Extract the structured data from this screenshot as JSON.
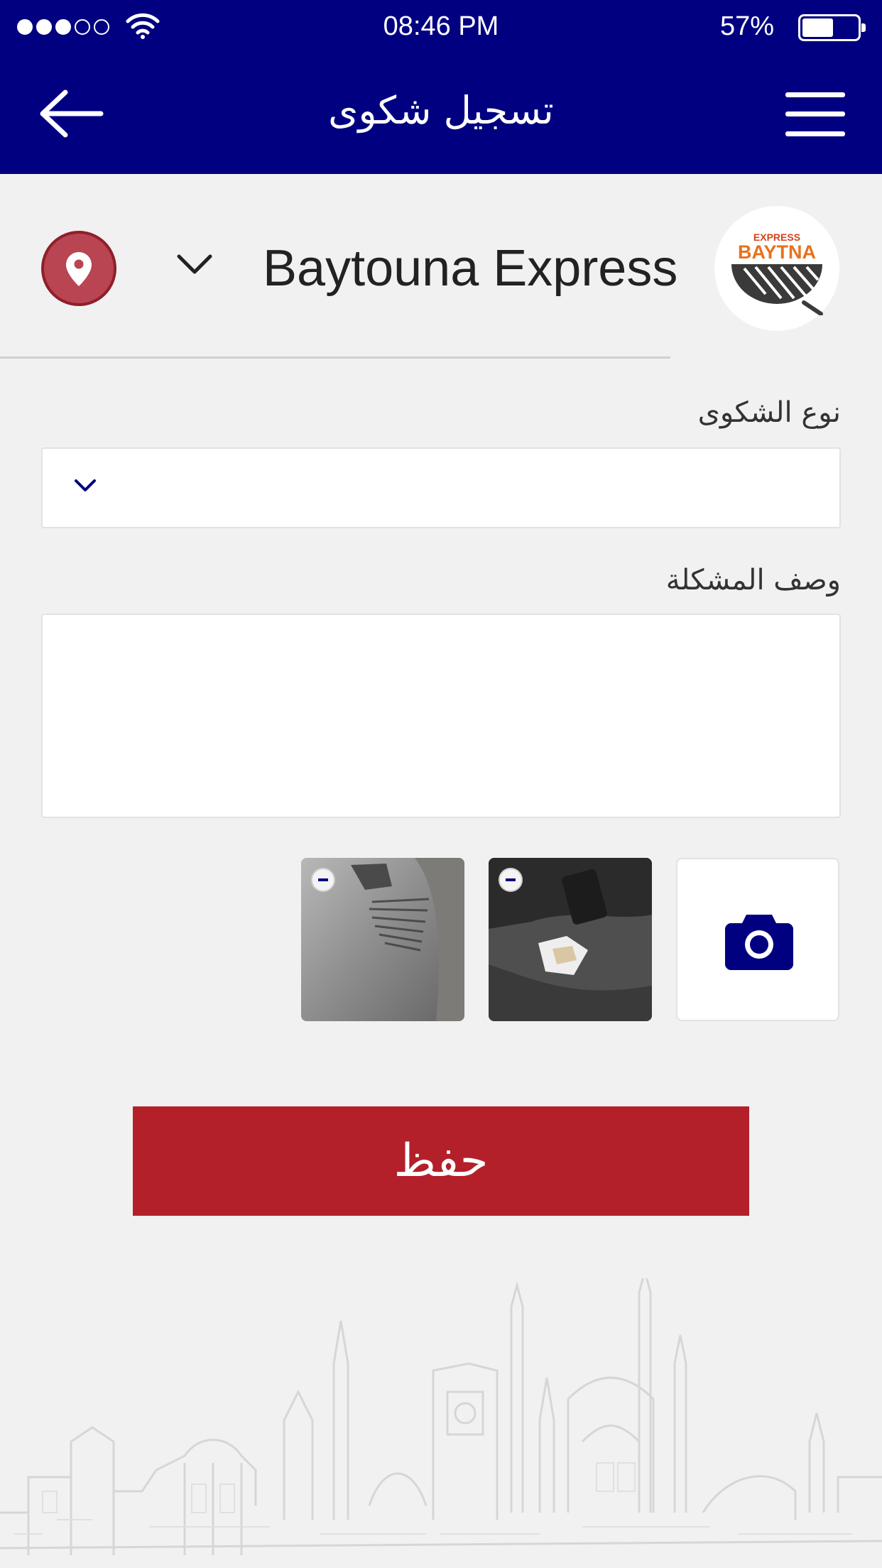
{
  "status_bar": {
    "time": "08:46 PM",
    "battery_percent": "57%",
    "battery_level": 0.57,
    "signal_bars_filled": 3,
    "signal_bars_total": 5
  },
  "header": {
    "title": "تسجيل شكوى",
    "back_icon": "arrow-left-icon",
    "menu_icon": "hamburger-menu-icon"
  },
  "branch": {
    "name": "Baytouna Express",
    "logo_small_text": "EXPRESS",
    "logo_big_text": "BAYTNA",
    "location_icon": "map-pin-icon"
  },
  "form": {
    "complaint_type_label": "نوع الشكوى",
    "complaint_type_value": "",
    "description_label": "وصف المشكلة",
    "description_value": ""
  },
  "photos": [
    {
      "description": "scratched car bumper"
    },
    {
      "description": "car floor with tissue"
    }
  ],
  "save_label": "حفظ",
  "colors": {
    "primary_navy": "#000080",
    "accent_red": "#b3202a",
    "location_red": "#b94452",
    "background": "#f1f1f1"
  }
}
